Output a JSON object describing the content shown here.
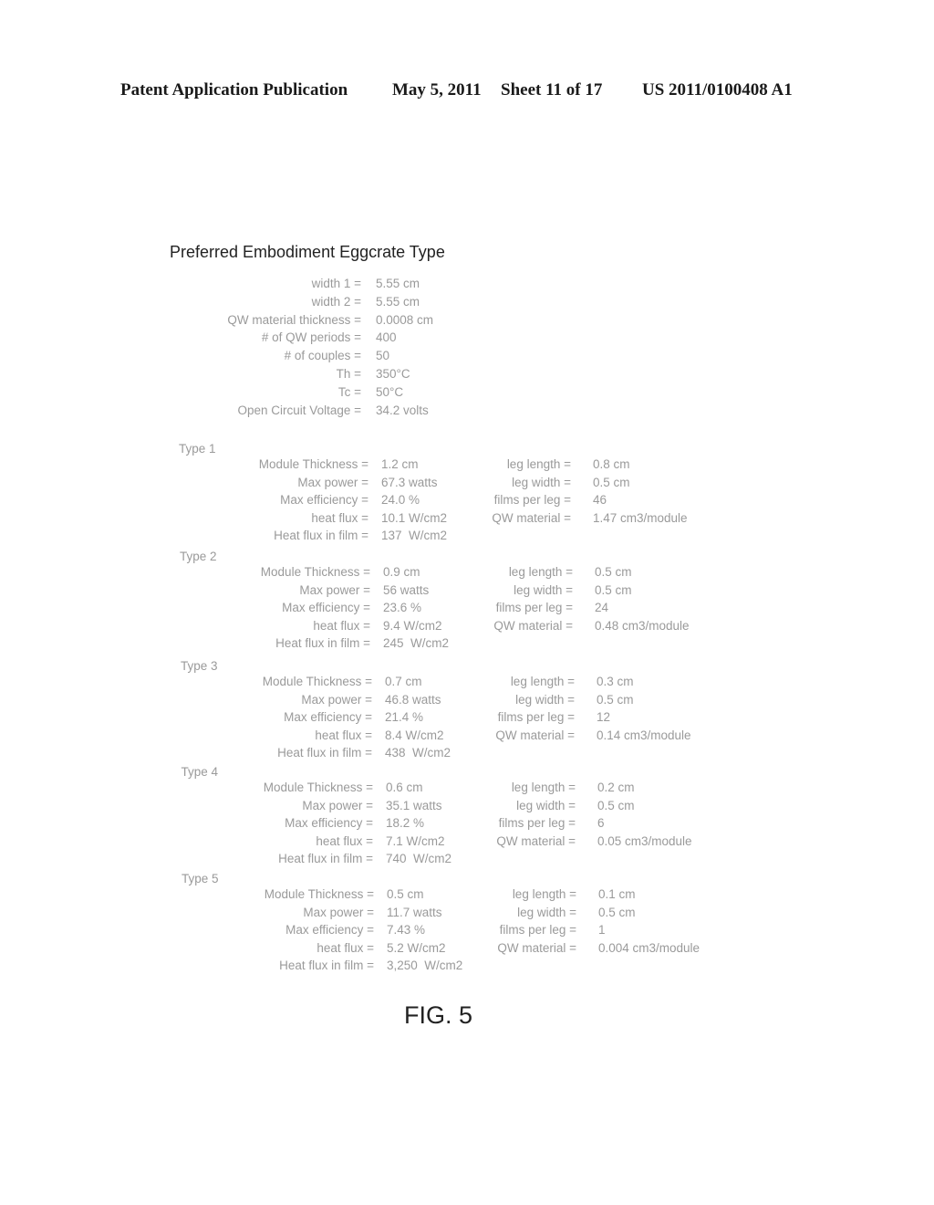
{
  "header": {
    "publication": "Patent Application Publication",
    "date": "May 5, 2011",
    "sheet": "Sheet 11 of 17",
    "number": "US 2011/0100408 A1"
  },
  "title": "Preferred Embodiment Eggcrate Type",
  "parameters": [
    {
      "label": "width 1 =",
      "value": "5.55 cm"
    },
    {
      "label": "width 2 =",
      "value": "5.55 cm"
    },
    {
      "label": "QW material thickness =",
      "value": "0.0008 cm"
    },
    {
      "label": "# of QW periods =",
      "value": "400"
    },
    {
      "label": "# of couples =",
      "value": "50"
    },
    {
      "label": "Th =",
      "value": "350°C"
    },
    {
      "label": "Tc =",
      "value": "50°C"
    },
    {
      "label": "Open Circuit Voltage =",
      "value": "34.2 volts"
    }
  ],
  "types": [
    {
      "name": "Type 1",
      "left": [
        {
          "label": "Module Thickness =",
          "value": "1.2 cm"
        },
        {
          "label": "Max power =",
          "value": "67.3 watts"
        },
        {
          "label": "Max efficiency =",
          "value": "24.0 %"
        },
        {
          "label": "heat flux =",
          "value": "10.1 W/cm2"
        },
        {
          "label": "Heat flux in film =",
          "value": "137  W/cm2"
        }
      ],
      "right": [
        {
          "label": "leg length =",
          "value": "0.8 cm"
        },
        {
          "label": "leg width =",
          "value": "0.5 cm"
        },
        {
          "label": "films per leg =",
          "value": "46"
        },
        {
          "label": "QW material =",
          "value": "1.47 cm3/module"
        }
      ]
    },
    {
      "name": "Type 2",
      "left": [
        {
          "label": "Module Thickness =",
          "value": "0.9 cm"
        },
        {
          "label": "Max power =",
          "value": "56 watts"
        },
        {
          "label": "Max efficiency =",
          "value": "23.6 %"
        },
        {
          "label": "heat flux =",
          "value": "9.4 W/cm2"
        },
        {
          "label": "Heat flux in film =",
          "value": "245  W/cm2"
        }
      ],
      "right": [
        {
          "label": "leg length =",
          "value": "0.5 cm"
        },
        {
          "label": "leg width =",
          "value": "0.5 cm"
        },
        {
          "label": "films per leg =",
          "value": "24"
        },
        {
          "label": "QW material =",
          "value": "0.48 cm3/module"
        }
      ]
    },
    {
      "name": "Type 3",
      "left": [
        {
          "label": "Module Thickness =",
          "value": "0.7 cm"
        },
        {
          "label": "Max power =",
          "value": "46.8 watts"
        },
        {
          "label": "Max efficiency =",
          "value": "21.4 %"
        },
        {
          "label": "heat flux =",
          "value": "8.4 W/cm2"
        },
        {
          "label": "Heat flux in film =",
          "value": "438  W/cm2"
        }
      ],
      "right": [
        {
          "label": "leg length =",
          "value": "0.3 cm"
        },
        {
          "label": "leg width =",
          "value": "0.5 cm"
        },
        {
          "label": "films per leg =",
          "value": "12"
        },
        {
          "label": "QW material =",
          "value": "0.14 cm3/module"
        }
      ]
    },
    {
      "name": "Type 4",
      "left": [
        {
          "label": "Module Thickness =",
          "value": "0.6 cm"
        },
        {
          "label": "Max power =",
          "value": "35.1 watts"
        },
        {
          "label": "Max efficiency =",
          "value": "18.2 %"
        },
        {
          "label": "heat flux =",
          "value": "7.1 W/cm2"
        },
        {
          "label": "Heat flux in film =",
          "value": "740  W/cm2"
        }
      ],
      "right": [
        {
          "label": "leg length =",
          "value": "0.2 cm"
        },
        {
          "label": "leg width =",
          "value": "0.5 cm"
        },
        {
          "label": "films per leg =",
          "value": "6"
        },
        {
          "label": "QW material =",
          "value": "0.05 cm3/module"
        }
      ]
    },
    {
      "name": "Type 5",
      "left": [
        {
          "label": "Module Thickness =",
          "value": "0.5 cm"
        },
        {
          "label": "Max power =",
          "value": "11.7 watts"
        },
        {
          "label": "Max efficiency =",
          "value": "7.43 %"
        },
        {
          "label": "heat flux =",
          "value": "5.2 W/cm2"
        },
        {
          "label": "Heat flux in film =",
          "value": "3,250  W/cm2"
        }
      ],
      "right": [
        {
          "label": "leg length =",
          "value": "0.1 cm"
        },
        {
          "label": "leg width =",
          "value": "0.5 cm"
        },
        {
          "label": "films per leg =",
          "value": "1"
        },
        {
          "label": "QW material =",
          "value": "0.004 cm3/module"
        }
      ]
    }
  ],
  "figure_label": "FIG. 5"
}
